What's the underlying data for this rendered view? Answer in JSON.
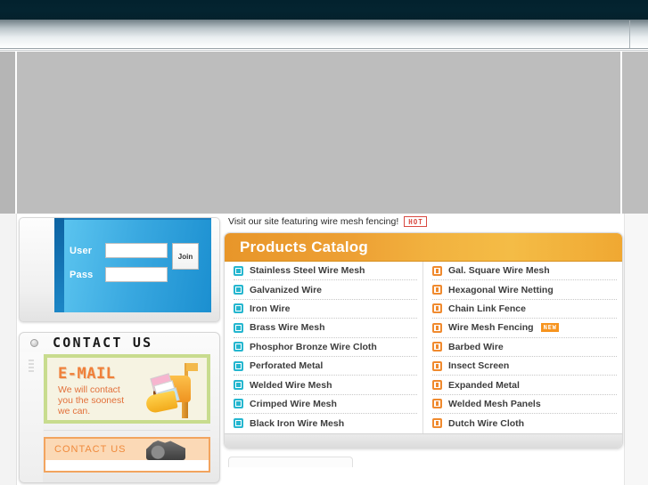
{
  "browser": {
    "titlebar_color": "#042430",
    "toolbar_gradient_top": "#6f7d84",
    "toolbar_gradient_bottom": "#ffffff"
  },
  "page": {
    "blank_region_color": "#bdbdbd"
  },
  "sidebar": {
    "login": {
      "user_label": "User",
      "user_value": "",
      "user_placeholder": "",
      "pass_label": "Pass",
      "pass_value": "",
      "pass_placeholder": "",
      "join_label": "Join",
      "panel_color": "#39a8e0"
    },
    "contact": {
      "title": "CONTACT US",
      "email_banner": {
        "heading": "E-MAIL",
        "text": "We will contact\nyou the soonest\nwe can.",
        "text_line1": "We will contact",
        "text_line2": "you the soonest",
        "text_line3": "we can.",
        "border_color": "#c8dc8e",
        "heading_color": "#f0803a",
        "icon": "mailbox-icon"
      },
      "card": {
        "title": "CONTACT US",
        "accent_color": "#f2a45f",
        "icon": "machine-photo"
      }
    }
  },
  "main": {
    "notice": {
      "text": "Visit our site featuring wire mesh fencing!",
      "badge": "HOT",
      "badge_color": "#d94a42"
    },
    "catalog": {
      "title": "Products Catalog",
      "header_color": "#eda034",
      "left_column": [
        {
          "label": "Stainless Steel Wire Mesh",
          "icon": "teal-square-icon",
          "badge": ""
        },
        {
          "label": "Galvanized Wire",
          "icon": "teal-square-icon",
          "badge": ""
        },
        {
          "label": "Iron Wire",
          "icon": "teal-square-icon",
          "badge": ""
        },
        {
          "label": "Brass Wire Mesh",
          "icon": "teal-square-icon",
          "badge": ""
        },
        {
          "label": "Phosphor Bronze Wire Cloth",
          "icon": "teal-square-icon",
          "badge": ""
        },
        {
          "label": "Perforated Metal",
          "icon": "teal-square-icon",
          "badge": ""
        },
        {
          "label": "Welded Wire Mesh",
          "icon": "teal-square-icon",
          "badge": ""
        },
        {
          "label": "Crimped Wire Mesh",
          "icon": "teal-square-icon",
          "badge": ""
        },
        {
          "label": "Black Iron Wire Mesh",
          "icon": "teal-square-icon",
          "badge": ""
        }
      ],
      "right_column": [
        {
          "label": "Gal. Square Wire Mesh",
          "icon": "orange-square-icon",
          "badge": ""
        },
        {
          "label": "Hexagonal Wire Netting",
          "icon": "orange-square-icon",
          "badge": ""
        },
        {
          "label": "Chain Link Fence",
          "icon": "orange-square-icon",
          "badge": ""
        },
        {
          "label": "Wire Mesh Fencing",
          "icon": "orange-square-icon",
          "badge": "NEW"
        },
        {
          "label": "Barbed Wire",
          "icon": "orange-square-icon",
          "badge": ""
        },
        {
          "label": "Insect Screen",
          "icon": "orange-square-icon",
          "badge": ""
        },
        {
          "label": "Expanded Metal",
          "icon": "orange-square-icon",
          "badge": ""
        },
        {
          "label": "Welded Mesh Panels",
          "icon": "orange-square-icon",
          "badge": ""
        },
        {
          "label": "Dutch Wire Cloth",
          "icon": "orange-square-icon",
          "badge": ""
        }
      ]
    }
  }
}
